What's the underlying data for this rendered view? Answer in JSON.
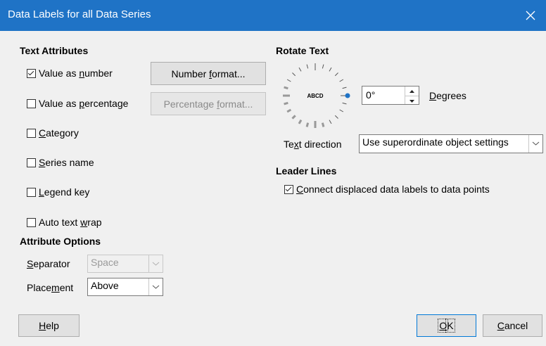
{
  "window": {
    "title": "Data Labels for all Data Series",
    "close_icon": "close-icon"
  },
  "text_attributes": {
    "heading": "Text Attributes",
    "value_as_number": {
      "pre": "Value as ",
      "u": "n",
      "post": "umber",
      "checked": true
    },
    "value_as_percentage": {
      "pre": "Value as ",
      "u": "p",
      "post": "ercentage",
      "checked": false
    },
    "category": {
      "pre": "",
      "u": "C",
      "post": "ategory",
      "checked": false
    },
    "series_name": {
      "pre": "",
      "u": "S",
      "post": "eries name",
      "checked": false
    },
    "legend_key": {
      "pre": "",
      "u": "L",
      "post": "egend key",
      "checked": false
    },
    "auto_text_wrap": {
      "pre": "Auto text ",
      "u": "w",
      "post": "rap",
      "checked": false
    },
    "number_format_button": {
      "pre": "Number ",
      "u": "f",
      "post": "ormat..."
    },
    "percentage_format_button": {
      "pre": "Percentage ",
      "u": "f",
      "post": "ormat..."
    }
  },
  "attribute_options": {
    "heading": "Attribute Options",
    "separator": {
      "pre": "",
      "u": "S",
      "post": "eparator",
      "value": "Space"
    },
    "placement": {
      "pre": "Place",
      "u": "m",
      "post": "ent",
      "value": "Above"
    }
  },
  "rotate_text": {
    "heading": "Rotate Text",
    "dial_label": "ABCD",
    "degrees_value": "0°",
    "degrees_label": {
      "pre": "",
      "u": "D",
      "post": "egrees"
    },
    "text_direction_label": {
      "pre": "Te",
      "u": "x",
      "post": "t direction"
    },
    "text_direction_value": "Use superordinate object settings"
  },
  "leader_lines": {
    "heading": "Leader Lines",
    "connect": {
      "pre": "",
      "u": "C",
      "post": "onnect displaced data labels to data points",
      "checked": true
    }
  },
  "buttons": {
    "help": {
      "pre": "",
      "u": "H",
      "post": "elp"
    },
    "ok": {
      "pre": "",
      "u": "O",
      "post": "K"
    },
    "cancel": {
      "pre": "",
      "u": "C",
      "post": "ancel"
    }
  },
  "colors": {
    "titlebar": "#1f73c6",
    "accent": "#0078d7"
  }
}
